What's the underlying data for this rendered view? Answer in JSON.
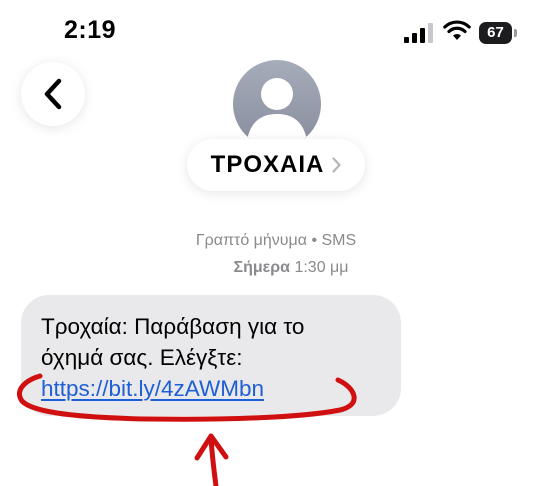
{
  "status_bar": {
    "time": "2:19",
    "battery_level": "67",
    "signal_bars": 3,
    "wifi": true
  },
  "header": {
    "back_icon": "chevron-left-icon",
    "contact_name": "ΤΡΟΧΑΙΑ",
    "contact_chevron": "chevron-right-icon"
  },
  "conversation": {
    "message_type": "Γραπτό μήνυμα • SMS",
    "timestamp_day": "Σήμερα",
    "timestamp_time": "1:30 μμ",
    "messages": [
      {
        "text": "Τροχαία: Παράβαση για το όχημά σας. Ελέγξτε:",
        "link": "https://bit.ly/4zAWMbn"
      }
    ]
  },
  "annotation": {
    "color": "#d01010"
  },
  "colors": {
    "bubble": "#e9e9eb",
    "link": "#1f5fd6",
    "meta_text": "#8a8a8e"
  }
}
